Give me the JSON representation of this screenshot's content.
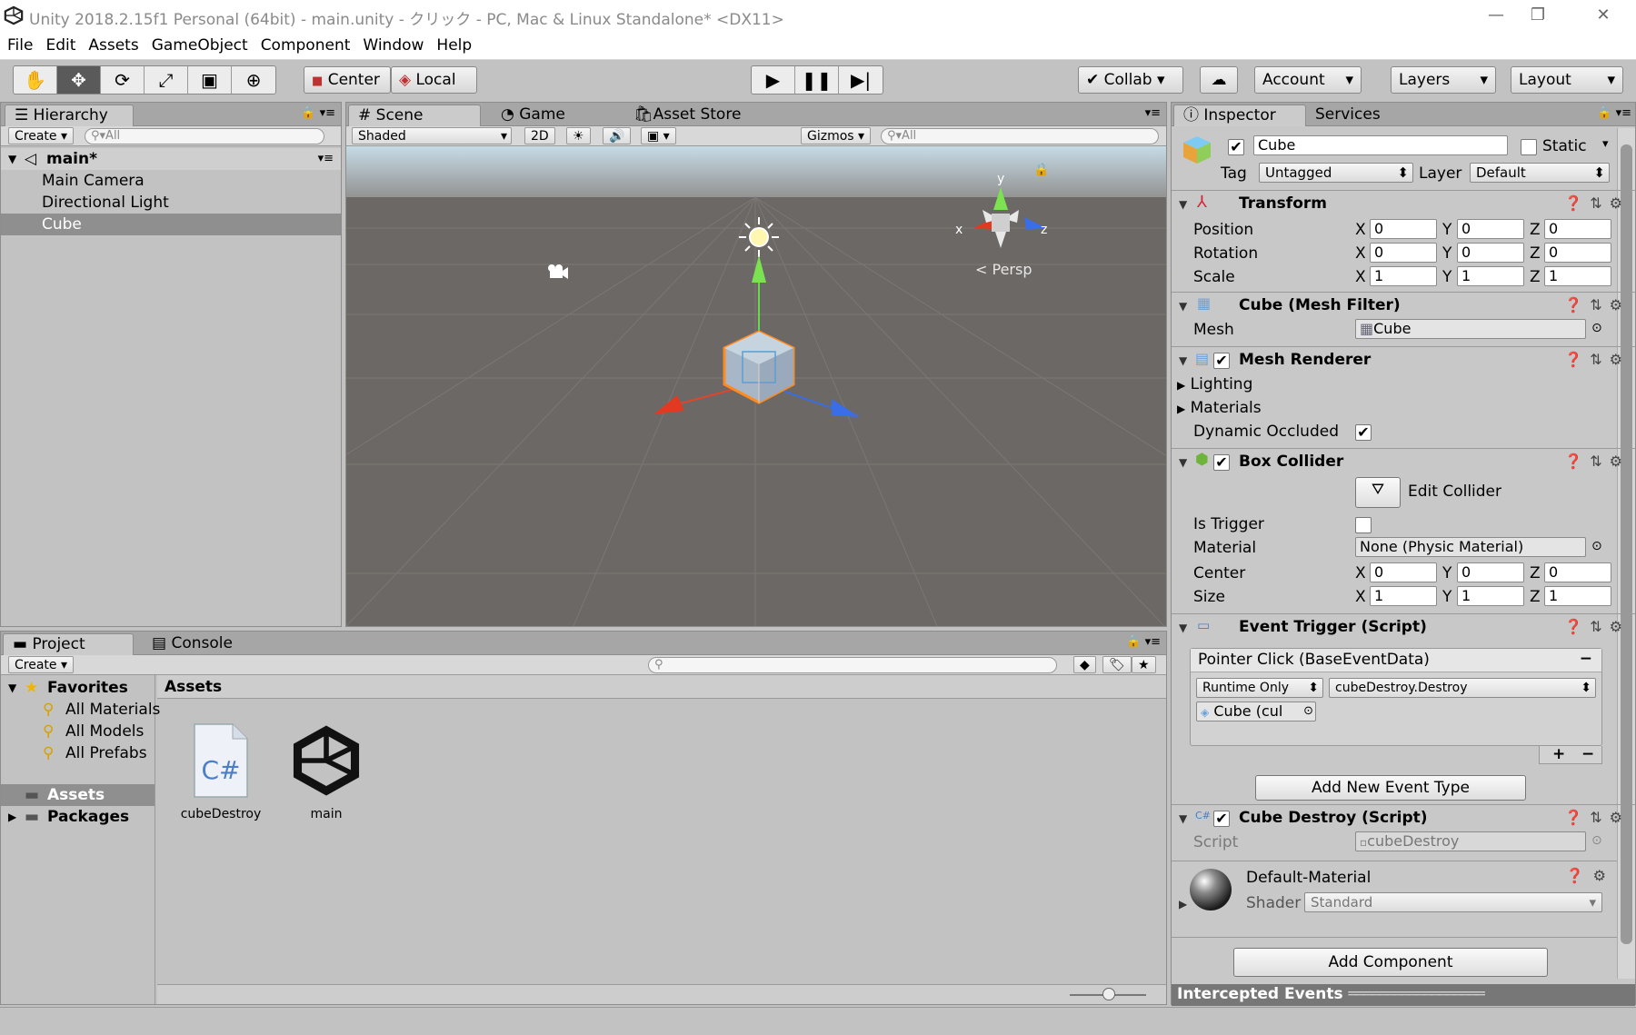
{
  "window": {
    "title": "Unity 2018.2.15f1 Personal (64bit) - main.unity - クリック - PC, Mac & Linux Standalone* <DX11>",
    "minimize": "—",
    "maximize": "❐",
    "close": "✕"
  },
  "menu": [
    "File",
    "Edit",
    "Assets",
    "GameObject",
    "Component",
    "Window",
    "Help"
  ],
  "toolbar": {
    "pivot": "Center",
    "space": "Local",
    "collab": "Collab",
    "account": "Account",
    "layers": "Layers",
    "layout": "Layout"
  },
  "hierarchy": {
    "tab": "Hierarchy",
    "create": "Create",
    "search_placeholder": "All",
    "scene": "main*",
    "items": [
      "Main Camera",
      "Directional Light",
      "Cube"
    ],
    "selected": "Cube"
  },
  "scene": {
    "tabs": [
      "Scene",
      "Game",
      "Asset Store"
    ],
    "shading": "Shaded",
    "mode2d": "2D",
    "gizmos": "Gizmos",
    "search_placeholder": "All",
    "persp": "< Persp",
    "axis_x": "x",
    "axis_y": "y",
    "axis_z": "z"
  },
  "project": {
    "tabs": [
      "Project",
      "Console"
    ],
    "create": "Create",
    "favorites": "Favorites",
    "favorite_items": [
      "All Materials",
      "All Models",
      "All Prefabs"
    ],
    "folders": [
      "Assets",
      "Packages"
    ],
    "breadcrumb": "Assets",
    "assets": [
      {
        "name": "cubeDestroy",
        "icon": "csharp-script-icon",
        "glyph": "C#"
      },
      {
        "name": "main",
        "icon": "unity-scene-icon"
      }
    ]
  },
  "inspector": {
    "tabs": [
      "Inspector",
      "Services"
    ],
    "object_name": "Cube",
    "static_label": "Static",
    "tag_label": "Tag",
    "tag_value": "Untagged",
    "layer_label": "Layer",
    "layer_value": "Default",
    "transform": {
      "title": "Transform",
      "rows": [
        {
          "label": "Position",
          "x": "0",
          "y": "0",
          "z": "0"
        },
        {
          "label": "Rotation",
          "x": "0",
          "y": "0",
          "z": "0"
        },
        {
          "label": "Scale",
          "x": "1",
          "y": "1",
          "z": "1"
        }
      ]
    },
    "mesh_filter": {
      "title": "Cube (Mesh Filter)",
      "mesh_label": "Mesh",
      "mesh_value": "Cube"
    },
    "mesh_renderer": {
      "title": "Mesh Renderer",
      "lighting": "Lighting",
      "materials": "Materials",
      "dynamic_occluded": "Dynamic Occluded"
    },
    "box_collider": {
      "title": "Box Collider",
      "edit_collider": "Edit Collider",
      "is_trigger": "Is Trigger",
      "material_label": "Material",
      "material_value": "None (Physic Material)",
      "center": {
        "label": "Center",
        "x": "0",
        "y": "0",
        "z": "0"
      },
      "size": {
        "label": "Size",
        "x": "1",
        "y": "1",
        "z": "1"
      }
    },
    "event_trigger": {
      "title": "Event Trigger (Script)",
      "event": "Pointer Click (BaseEventData)",
      "runtime": "Runtime Only",
      "function": "cubeDestroy.Destroy",
      "target": "Cube (cul",
      "add_event": "Add New Event Type"
    },
    "cube_destroy": {
      "title": "Cube Destroy (Script)",
      "script_label": "Script",
      "script_value": "cubeDestroy"
    },
    "material": {
      "name": "Default-Material",
      "shader_label": "Shader",
      "shader_value": "Standard"
    },
    "add_component": "Add Component",
    "intercepted": "Intercepted Events"
  },
  "axes": [
    "X",
    "Y",
    "Z"
  ]
}
